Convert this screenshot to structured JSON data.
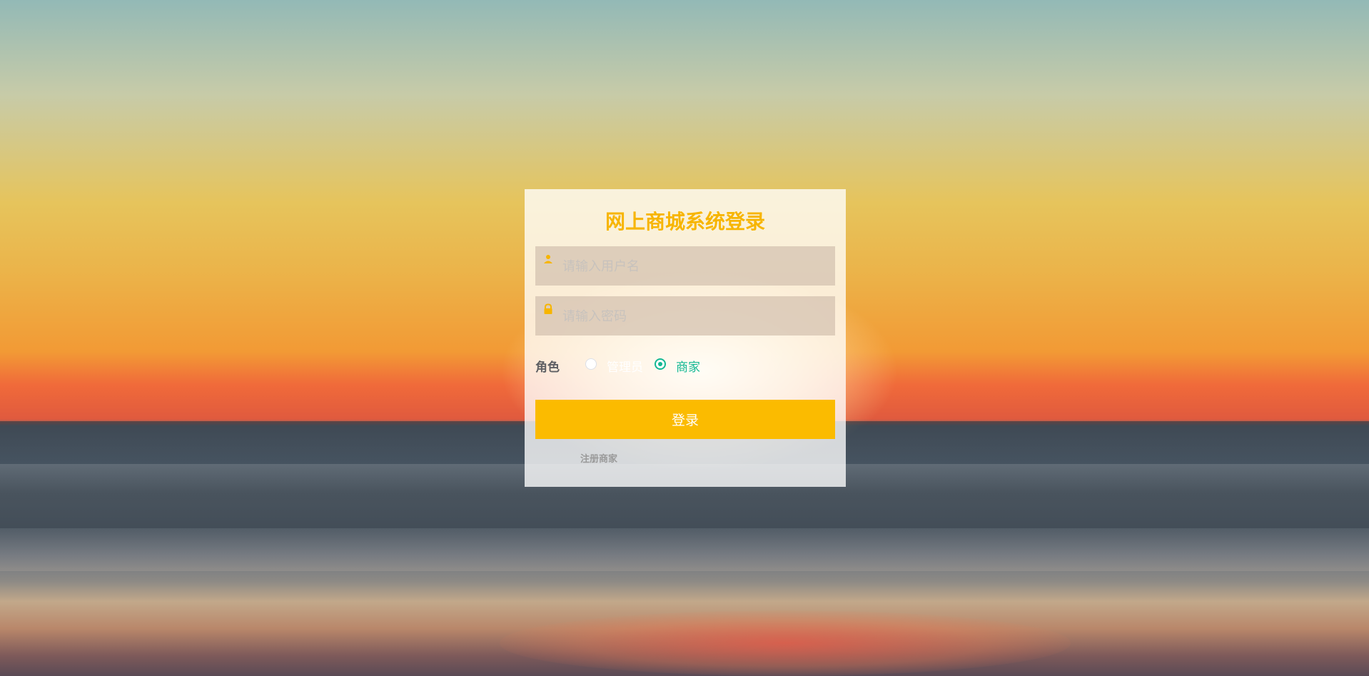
{
  "login": {
    "title": "网上商城系统登录",
    "username_placeholder": "请输入用户名",
    "password_placeholder": "请输入密码",
    "role_label": "角色",
    "roles": [
      {
        "label": "管理员",
        "selected": false
      },
      {
        "label": "商家",
        "selected": true
      }
    ],
    "login_button": "登录",
    "register_link": "注册商家"
  },
  "icons": {
    "username": "user-icon",
    "password": "lock-icon"
  },
  "colors": {
    "accent": "#fbbb00",
    "title": "#f7b500",
    "selected_radio": "#13b893"
  }
}
